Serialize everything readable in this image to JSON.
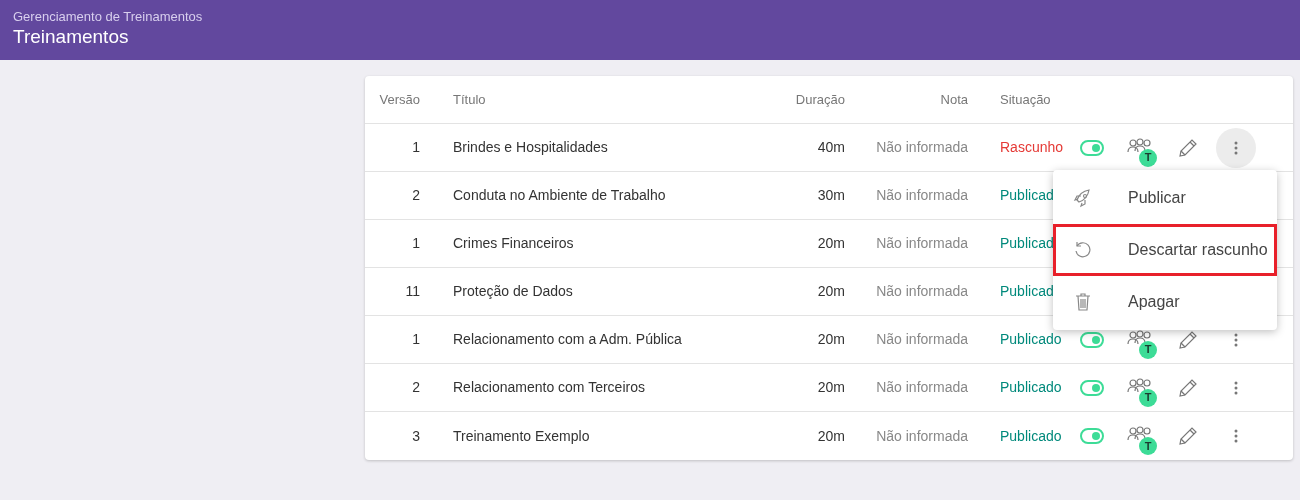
{
  "header": {
    "breadcrumb": "Gerenciamento de Treinamentos",
    "title": "Treinamentos"
  },
  "table": {
    "columns": [
      "Versão",
      "Título",
      "Duração",
      "Nota",
      "Situação"
    ],
    "rows": [
      {
        "version": "1",
        "title": "Brindes e Hospitalidades",
        "duration": "40m",
        "grade": "Não informada",
        "status": "Rascunho",
        "draft": true,
        "toggle_on": true,
        "badge": "T",
        "menu_open": true
      },
      {
        "version": "2",
        "title": "Conduta no Ambiente de Trabalho",
        "duration": "30m",
        "grade": "Não informada",
        "status": "Publicad",
        "draft": false
      },
      {
        "version": "1",
        "title": "Crimes Financeiros",
        "duration": "20m",
        "grade": "Não informada",
        "status": "Publicad",
        "draft": false
      },
      {
        "version": "11",
        "title": "Proteção de Dados",
        "duration": "20m",
        "grade": "Não informada",
        "status": "Publicad",
        "draft": false
      },
      {
        "version": "1",
        "title": "Relacionamento com a Adm. Pública",
        "duration": "20m",
        "grade": "Não informada",
        "status": "Publicado",
        "draft": false,
        "toggle_on": true,
        "badge": "T",
        "menu_open": false
      },
      {
        "version": "2",
        "title": "Relacionamento com Terceiros",
        "duration": "20m",
        "grade": "Não informada",
        "status": "Publicado",
        "draft": false,
        "toggle_on": true,
        "badge": "T",
        "menu_open": false
      },
      {
        "version": "3",
        "title": "Treinamento Exemplo",
        "duration": "20m",
        "grade": "Não informada",
        "status": "Publicado",
        "draft": false,
        "toggle_on": true,
        "badge": "T",
        "menu_open": false
      }
    ]
  },
  "menu": {
    "items": [
      {
        "kind": "publish",
        "label": "Publicar",
        "highlighted": false
      },
      {
        "kind": "discard",
        "label": "Descartar rascunho",
        "highlighted": true
      },
      {
        "kind": "delete",
        "label": "Apagar",
        "highlighted": false
      }
    ]
  }
}
